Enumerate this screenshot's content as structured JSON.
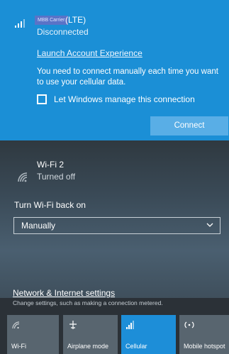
{
  "cellular": {
    "carrier": "MBB Carrier",
    "network_type": "(LTE)",
    "status": "Disconnected",
    "launch_link": "Launch Account Experience",
    "message": "You need to connect manually each time you want to use your cellular data.",
    "checkbox_label": "Let Windows manage this connection",
    "checkbox_checked": false,
    "connect_label": "Connect"
  },
  "wifi": {
    "name": "Wi-Fi 2",
    "status": "Turned off",
    "turn_on_label": "Turn Wi-Fi back on",
    "dropdown_value": "Manually",
    "settings_link": "Network & Internet settings",
    "settings_desc": "Change settings, such as making a connection metered."
  },
  "quick_actions": [
    {
      "label": "Wi-Fi",
      "icon": "wifi-icon",
      "active": false
    },
    {
      "label": "Airplane mode",
      "icon": "airplane-icon",
      "active": false
    },
    {
      "label": "Cellular",
      "icon": "cellular-icon",
      "active": true
    },
    {
      "label": "Mobile hotspot",
      "icon": "hotspot-icon",
      "active": false
    }
  ],
  "colors": {
    "accent": "#1b8fd6",
    "tile_active": "#1d8ed8",
    "tile_inactive": "#58656f",
    "connect_button": "#59aee6"
  }
}
